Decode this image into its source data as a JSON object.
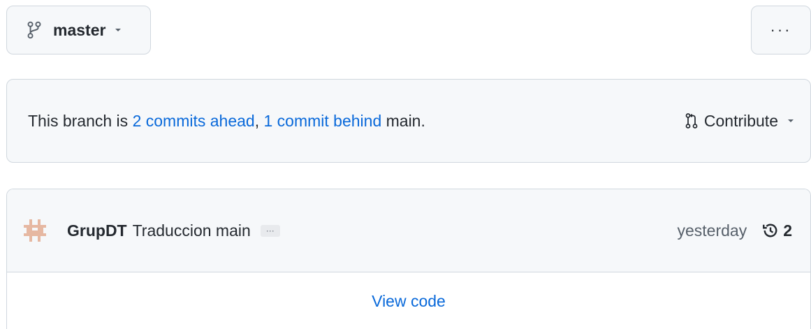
{
  "branch": {
    "name": "master",
    "icon": "git-branch-icon"
  },
  "more_button": {
    "label": "···",
    "icon": "kebab-horizontal-icon"
  },
  "status": {
    "prefix": "This branch is ",
    "ahead_link": "2 commits ahead",
    "separator": ", ",
    "behind_link": "1 commit behind",
    "suffix": " main."
  },
  "contribute": {
    "label": "Contribute",
    "icon": "git-pull-request-icon"
  },
  "commit": {
    "author": "GrupDT",
    "message": "Traduccion main",
    "expander": "···",
    "time": "yesterday",
    "history_count": "2",
    "history_icon": "history-icon"
  },
  "view_code": {
    "label": "View code"
  },
  "colors": {
    "link": "#0969da",
    "border": "#d0d7de",
    "box_bg": "#f6f8fa",
    "text": "#24292f",
    "muted": "#57606a"
  }
}
